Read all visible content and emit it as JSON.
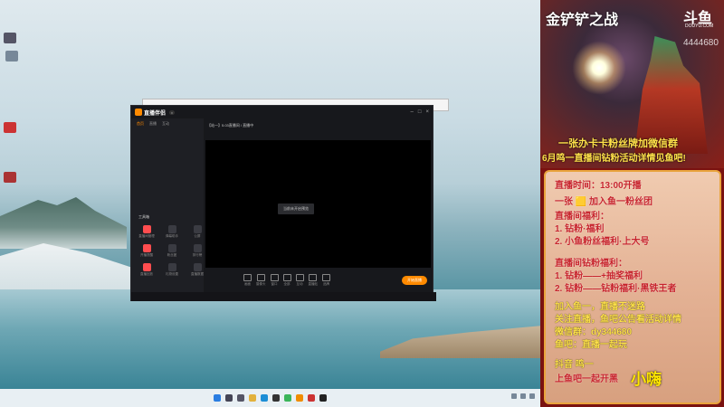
{
  "window": {
    "app_name": "直播伴侣",
    "room_line": "【站一】5.03直播间 / 直播中",
    "preview_button": "当前未开启预览",
    "start_button": "开始直播",
    "sidebar_title": "工具箱",
    "nav": [
      "首页",
      "直播",
      "互动"
    ],
    "tools": [
      {
        "label": "直播间管理",
        "hot": true
      },
      {
        "label": "弹幕助手",
        "hot": false
      },
      {
        "label": "公屏",
        "hot": false
      },
      {
        "label": "开播提醒",
        "hot": true
      },
      {
        "label": "粉丝团",
        "hot": false
      },
      {
        "label": "排行榜",
        "hot": false
      },
      {
        "label": "直播回放",
        "hot": true
      },
      {
        "label": "礼物设置",
        "hot": false
      },
      {
        "label": "直播数据",
        "hot": false
      }
    ],
    "toolbar": [
      "画面",
      "摄像头",
      "窗口",
      "全部",
      "互动",
      "直播贴",
      "品牌"
    ]
  },
  "panel": {
    "title": "金铲铲之战",
    "douyu": "斗鱼",
    "douyu_sub": "DOUYU.COM",
    "room_id": "4444680",
    "line1": "一张办卡卡粉丝牌加微信群",
    "line2": "6月鸣一直播间钻粉活动详情见鱼吧!",
    "board_lines": [
      {
        "text": "直播时间：13:00开播",
        "style": "r"
      },
      {
        "text": "一张 🟨 加入鱼一粉丝团",
        "style": "r"
      },
      {
        "text": "直播间福利：",
        "style": "r"
      },
      {
        "text": "1. 钻粉·福利",
        "style": "r"
      },
      {
        "text": "2. 小鱼粉丝福利·上大号",
        "style": "r"
      },
      {
        "text": "直播间钻粉福利：",
        "style": "r"
      },
      {
        "text": "1. 钻粉——+抽奖福利",
        "style": "r"
      },
      {
        "text": "2. 钻粉——钻粉福利·黑铁王者",
        "style": "r"
      },
      {
        "text": "加入鱼一，直播不迷路",
        "style": "y"
      },
      {
        "text": "关注直播，鱼吧公告看活动详情",
        "style": "y"
      },
      {
        "text": "微信群：dy344680",
        "style": "y"
      },
      {
        "text": "鱼吧：直播一起玩",
        "style": "y"
      },
      {
        "text": "抖音 鸣一",
        "style": "y"
      },
      {
        "text": "上鱼吧一起开黑",
        "style": "r"
      }
    ],
    "signature": "小嗨"
  }
}
